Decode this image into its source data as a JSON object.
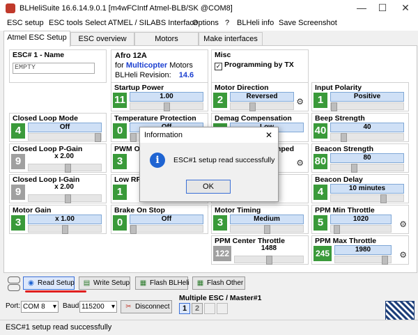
{
  "window": {
    "title": "BLHeliSuite 16.6.14.9.0.1   [m4wFCIntf Atmel-BLB/SK @COM8]",
    "minimize": "—",
    "maximize": "☐",
    "close": "✕"
  },
  "menu": [
    "ESC setup",
    "ESC tools",
    "Select ATMEL / SILABS Interface",
    "Options",
    "?",
    "BLHeli info",
    "Save Screenshot"
  ],
  "tabs": [
    "Atmel ESC Setup",
    "ESC overview",
    "Motors",
    "Make interfaces"
  ],
  "esc_name": {
    "title": "ESC# 1 - Name",
    "value": "EMPTY"
  },
  "esc_info": {
    "line1": "Afro 12A",
    "for_label": "for",
    "multicopter": "Multicopter",
    "motors": "Motors",
    "revision_label": "BLHeli Revision:",
    "revision": "14.6"
  },
  "misc": {
    "title": "Misc",
    "programming_by_tx": "Programming by TX"
  },
  "panels": {
    "startup_power": {
      "title": "Startup Power",
      "num": "11",
      "value": "1.00",
      "position": 0.5
    },
    "motor_direction": {
      "title": "Motor Direction",
      "num": "2",
      "value": "Reversed",
      "position": 0.33
    },
    "input_polarity": {
      "title": "Input Polarity",
      "num": "1",
      "value": "Positive",
      "position": 0.0
    },
    "closed_loop_mode": {
      "title": "Closed Loop Mode",
      "num": "4",
      "value": "Off",
      "position": 1.0
    },
    "temperature_protection": {
      "title": "Temperature Protection",
      "num": "0",
      "value": "Off",
      "position": 0.0
    },
    "demag_compensation": {
      "title": "Demag Compensation",
      "num": "",
      "value": "Low",
      "position": 0.0
    },
    "beep_strength": {
      "title": "Beep Strength",
      "num": "40",
      "value": "40",
      "position": 0.15
    },
    "closed_loop_p_gain": {
      "title": "Closed Loop P-Gain",
      "num": "9",
      "value": "x 2.00",
      "position": 0.55
    },
    "pwm_output": {
      "title": "PWM Ou",
      "num": "3",
      "value": "",
      "position": 0.0
    },
    "damped": {
      "title": "mped",
      "num": "",
      "value": "",
      "position": 0.0
    },
    "beacon_strength": {
      "title": "Beacon Strength",
      "num": "80",
      "value": "80",
      "position": 0.3
    },
    "closed_loop_i_gain": {
      "title": "Closed Loop I-Gain",
      "num": "9",
      "value": "x 2.00",
      "position": 0.55
    },
    "low_rpm": {
      "title": "Low RPI",
      "num": "1",
      "value": "",
      "position": 0.0
    },
    "beacon_delay": {
      "title": "Beacon Delay",
      "num": "4",
      "value": "10 minutes",
      "position": 0.75
    },
    "motor_gain": {
      "title": "Motor Gain",
      "num": "3",
      "value": "x 1.00",
      "position": 0.5
    },
    "brake_on_stop": {
      "title": "Brake On Stop",
      "num": "0",
      "value": "Off",
      "position": 0.0
    },
    "motor_timing": {
      "title": "Motor Timing",
      "num": "3",
      "value": "Medium",
      "position": 0.5
    },
    "ppm_min_throttle": {
      "title": "PPM Min Throttle",
      "num": "5",
      "value": "1020",
      "position": 0.05
    },
    "ppm_center_throttle": {
      "title": "PPM Center Throttle",
      "num": "122",
      "value": "1488",
      "position": 0.5
    },
    "ppm_max_throttle": {
      "title": "PPM Max Throttle",
      "num": "245",
      "value": "1980",
      "position": 0.95
    }
  },
  "buttons": {
    "read_setup": "Read Setup",
    "write_setup": "Write Setup",
    "flash_blheli": "Flash BLHeli",
    "flash_other": "Flash Other",
    "disconnect": "Disconnect"
  },
  "connection": {
    "port_label": "Port:",
    "port": "COM 8",
    "baud_label": "Baud:",
    "baud": "115200"
  },
  "multiple_esc": {
    "label": "Multiple ESC / Master#1",
    "esc1": "1",
    "esc2": "2"
  },
  "status": "ESC#1 setup read successfully",
  "dialog": {
    "title": "Information",
    "close": "✕",
    "message": "ESC#1 setup read successfully",
    "ok": "OK",
    "icon": "i"
  },
  "colors": {
    "green_box": "#3a9a3a",
    "grey_box": "#a0a0a0",
    "value_bar": "#cfe0f6",
    "blue_text": "#1b3fd0"
  }
}
